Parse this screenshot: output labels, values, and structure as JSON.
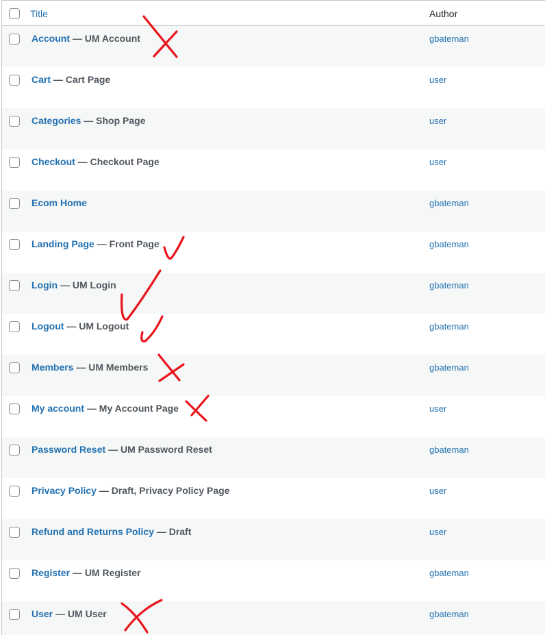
{
  "header": {
    "title_label": "Title",
    "author_label": "Author"
  },
  "separator": "—",
  "rows": [
    {
      "title": "Account",
      "state": "UM Account",
      "author": "gbateman",
      "mark": "cross"
    },
    {
      "title": "Cart",
      "state": "Cart Page",
      "author": "user",
      "mark": ""
    },
    {
      "title": "Categories",
      "state": "Shop Page",
      "author": "user",
      "mark": ""
    },
    {
      "title": "Checkout",
      "state": "Checkout Page",
      "author": "user",
      "mark": ""
    },
    {
      "title": "Ecom Home",
      "state": "",
      "author": "gbateman",
      "mark": ""
    },
    {
      "title": "Landing Page",
      "state": "Front Page",
      "author": "gbateman",
      "mark": "check"
    },
    {
      "title": "Login",
      "state": "UM Login",
      "author": "gbateman",
      "mark": "check"
    },
    {
      "title": "Logout",
      "state": "UM Logout",
      "author": "gbateman",
      "mark": "check"
    },
    {
      "title": "Members",
      "state": "UM Members",
      "author": "gbateman",
      "mark": "cross"
    },
    {
      "title": "My account",
      "state": "My Account Page",
      "author": "user",
      "mark": "cross"
    },
    {
      "title": "Password Reset",
      "state": "UM Password Reset",
      "author": "gbateman",
      "mark": ""
    },
    {
      "title": "Privacy Policy",
      "state": "Draft, Privacy Policy Page",
      "author": "user",
      "mark": ""
    },
    {
      "title": "Refund and Returns Policy",
      "state": "Draft",
      "author": "user",
      "mark": ""
    },
    {
      "title": "Register",
      "state": "UM Register",
      "author": "gbateman",
      "mark": ""
    },
    {
      "title": "User",
      "state": "UM User",
      "author": "gbateman",
      "mark": "cross"
    }
  ],
  "annotation_color": "#e8141c"
}
